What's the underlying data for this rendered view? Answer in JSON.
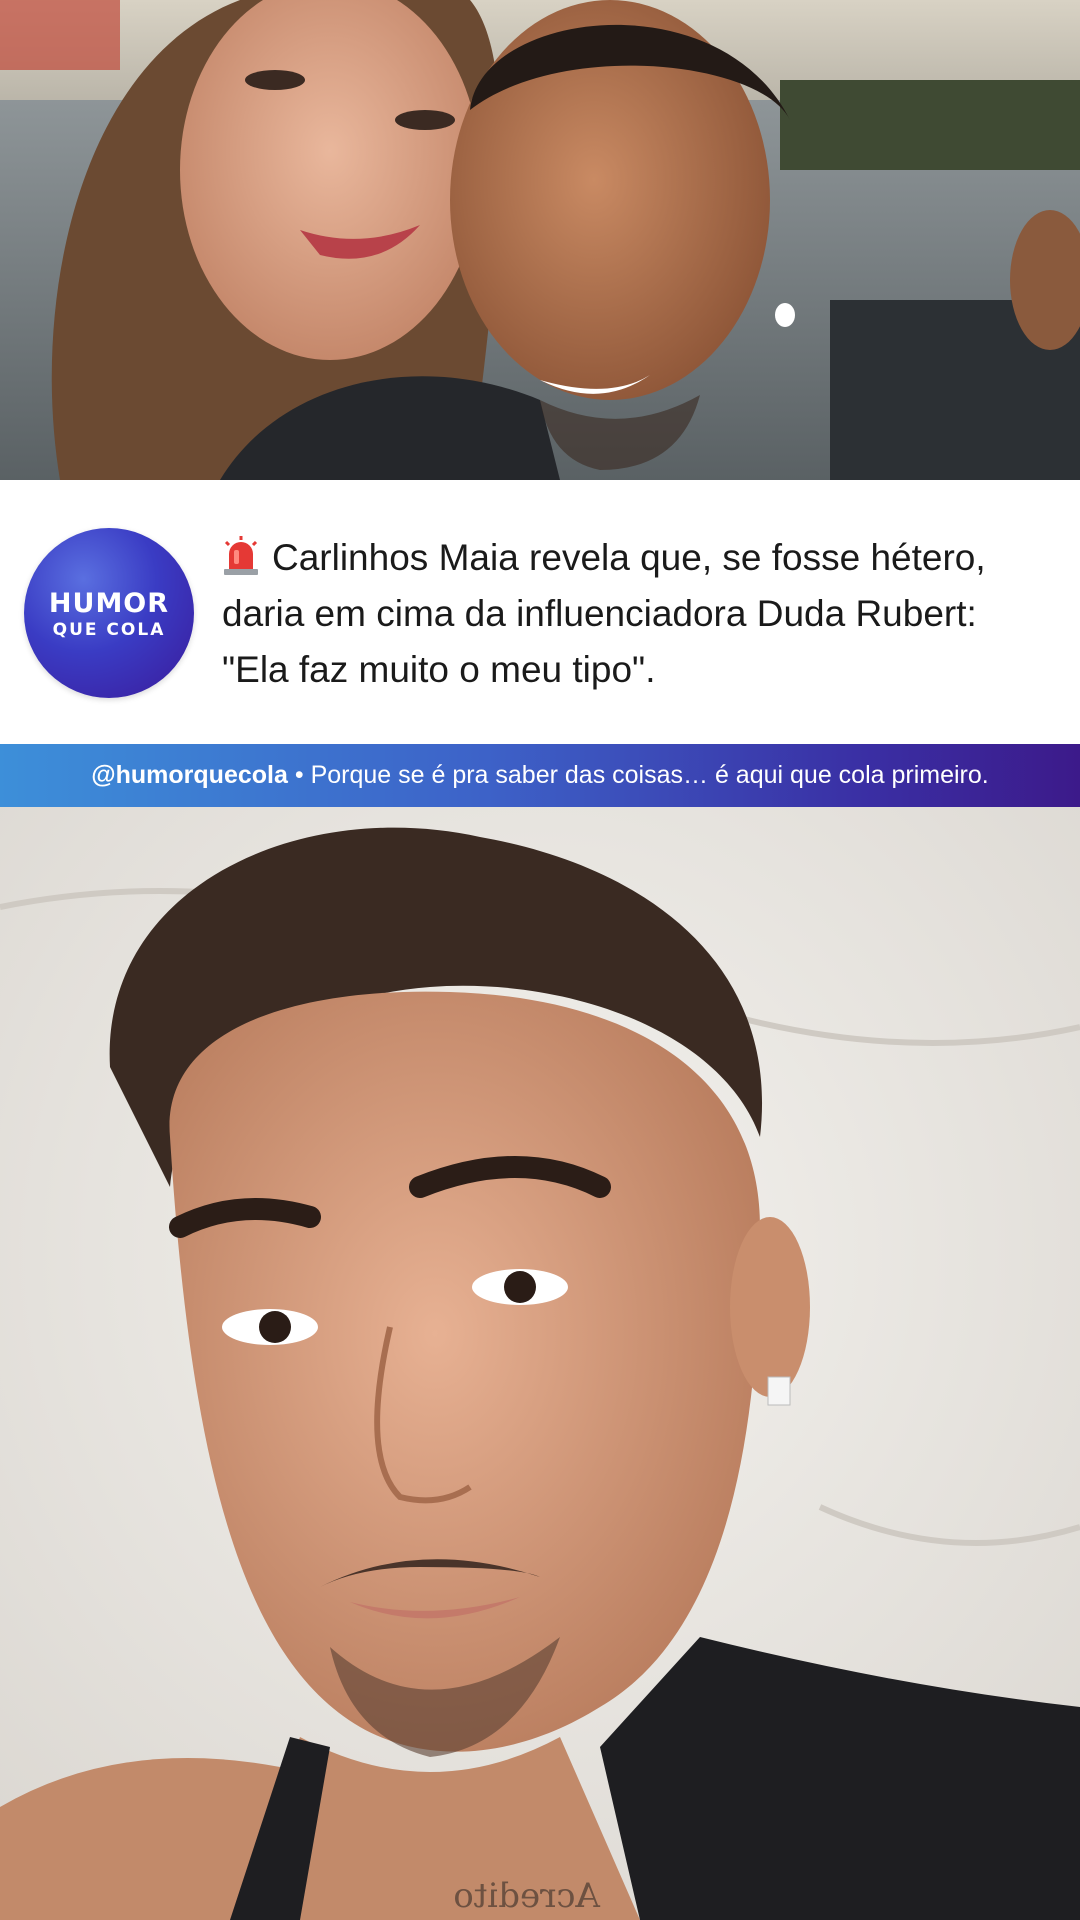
{
  "post": {
    "headline": "Carlinhos Maia revela que, se fosse hétero, daria em cima da influenciadora Duda Rubert: \"Ela faz muito o meu tipo\".",
    "headline_icon": "siren-icon"
  },
  "brand": {
    "logo_line1": "HUMOR",
    "logo_line2": "QUE COLA",
    "logo_color_primary": "#3a3cc4",
    "logo_color_secondary": "#3a1a9a"
  },
  "tagline": {
    "handle": "@humorquecola",
    "separator": "•",
    "text": "Porque se é pra saber das coisas… é aqui que cola primeiro.",
    "gradient_start": "#3d8fd9",
    "gradient_end": "#3c1a8a"
  },
  "images": {
    "top_photo": "couple-selfie-photo",
    "bottom_photo": "man-selfie-in-bed-photo"
  }
}
